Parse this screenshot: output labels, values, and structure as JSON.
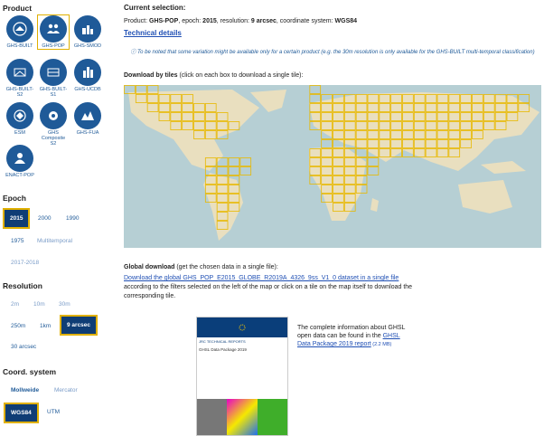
{
  "sidebar": {
    "product_title": "Product",
    "products": [
      {
        "label": "GHS-BUILT"
      },
      {
        "label": "GHS-POP"
      },
      {
        "label": "GHS-SMOD"
      },
      {
        "label": "GHS-BUILT-S2"
      },
      {
        "label": "GHS-BUILT-S1"
      },
      {
        "label": "GHS-UCDB"
      },
      {
        "label": "ESM"
      },
      {
        "label": "GHS Composite S2"
      },
      {
        "label": "GHS-FUA"
      },
      {
        "label": "ENACT-POP"
      }
    ],
    "epoch_title": "Epoch",
    "epochs": [
      "2015",
      "2000",
      "1990",
      "1975",
      "Multitemporal",
      "2017-2018"
    ],
    "resolution_title": "Resolution",
    "resolutions": [
      "2m",
      "10m",
      "30m",
      "250m",
      "1km",
      "9 arcsec",
      "30 arcsec"
    ],
    "coord_title": "Coord. system",
    "coords": [
      "Mollweide",
      "Mercator",
      "WGS84",
      "UTM"
    ]
  },
  "main": {
    "current_title": "Current selection:",
    "sel_prefix": "Product: ",
    "sel_product": "GHS-POP",
    "sel_epoch_prefix": ", epoch: ",
    "sel_epoch": "2015",
    "sel_res_prefix": ", resolution: ",
    "sel_res": "9 arcsec",
    "sel_coord_prefix": ", coordinate system: ",
    "sel_coord": "WGS84",
    "tech_link": "Technical details",
    "note": "To be noted that some variation might be available only for a certain product (e.g. the 30m resolution is only available for the GHS-BUILT multi-temporal classification)",
    "tiles_title": "Download by tiles",
    "tiles_hint": " (click on each box to download a single tile):",
    "global_title": "Global download",
    "global_hint": " (get the chosen data in a single file):",
    "global_link": "Download the global GHS_POP_E2015_GLOBE_R2019A_4326_9ss_V1_0 dataset in a single file",
    "filter_text": "according to the filters selected on the left of the map or click on a tile on the map itself to download the corresponding tile.",
    "info_text": "The complete information about GHSL open data can be found in the ",
    "info_link": "GHSL Data Package 2019 report",
    "info_size": " (2.2 MB)",
    "report_header": "JRC TECHNICAL REPORTS",
    "report_title": "GHSL Data Package 2019"
  }
}
